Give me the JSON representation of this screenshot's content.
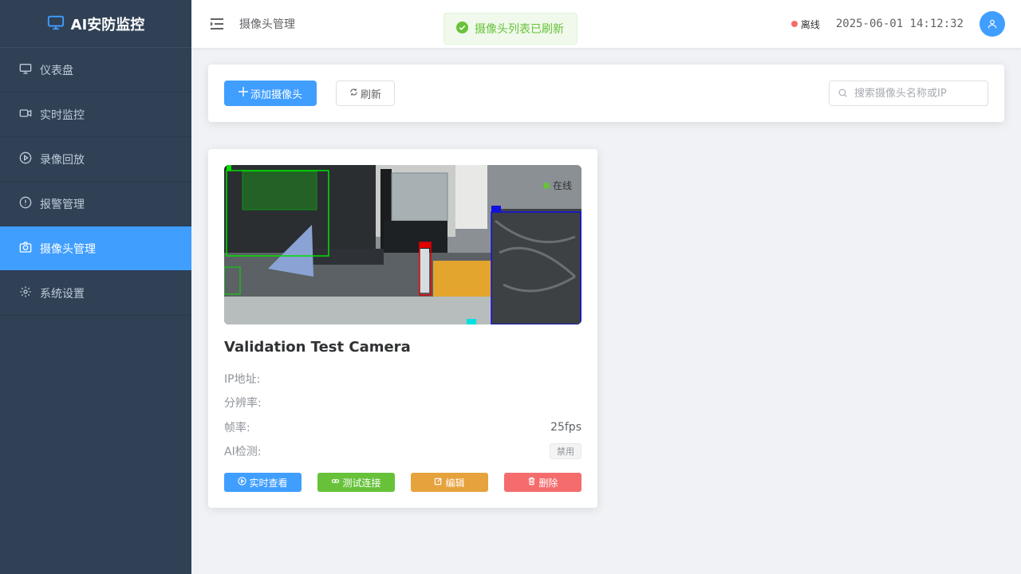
{
  "app": {
    "title": "AI安防监控"
  },
  "sidebar": {
    "items": [
      {
        "label": "仪表盘",
        "icon": "monitor-icon"
      },
      {
        "label": "实时监控",
        "icon": "video-camera-icon"
      },
      {
        "label": "录像回放",
        "icon": "play-circle-icon"
      },
      {
        "label": "报警管理",
        "icon": "warning-icon"
      },
      {
        "label": "摄像头管理",
        "icon": "camera-icon",
        "active": true
      },
      {
        "label": "系统设置",
        "icon": "gear-icon"
      }
    ]
  },
  "header": {
    "breadcrumb": "摄像头管理",
    "status": "离线",
    "datetime": "2025-06-01 14:12:32"
  },
  "toast": {
    "message": "摄像头列表已刷新"
  },
  "toolbar": {
    "add_label": "添加摄像头",
    "refresh_label": "刷新",
    "search_placeholder": "搜索摄像头名称或IP"
  },
  "cameras": [
    {
      "name": "Validation Test Camera",
      "status": "在线",
      "fields": {
        "ip_label": "IP地址:",
        "ip_value": "",
        "resolution_label": "分辨率:",
        "resolution_value": "",
        "fps_label": "帧率:",
        "fps_value": "25fps",
        "ai_label": "AI检测:",
        "ai_value": "禁用"
      },
      "actions": {
        "view": "实时查看",
        "test": "测试连接",
        "edit": "编辑",
        "delete": "删除"
      }
    }
  ],
  "colors": {
    "sidebar_bg": "#304156",
    "primary": "#409eff",
    "success": "#67c23a",
    "warning": "#e6a23c",
    "danger": "#f56c6c"
  }
}
